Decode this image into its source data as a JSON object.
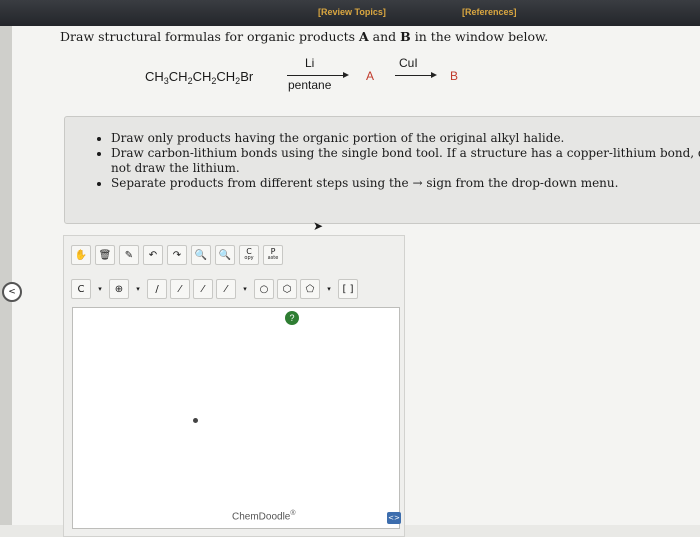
{
  "topbar": {
    "review_topics": "[Review Topics]",
    "references": "[References]"
  },
  "question": {
    "prefix": "Draw structural formulas for organic products ",
    "a": "A",
    "mid": " and ",
    "b": "B",
    "suffix": " in the window below."
  },
  "reaction": {
    "sm_parts": [
      "CH",
      "3",
      "CH",
      "2",
      "CH",
      "2",
      "CH",
      "2",
      "Br"
    ],
    "reagent1_top": "Li",
    "reagent1_bottom": "pentane",
    "product_a": "A",
    "reagent2_top": "CuI",
    "product_b": "B"
  },
  "instructions": [
    "Draw only products having the organic portion of the original alkyl halide.",
    "Draw carbon-lithium bonds using the single bond tool. If a structure has a copper-lithium bond, do not draw the lithium.",
    "Separate products from different steps using the → sign from the drop-down menu."
  ],
  "toolbar": {
    "row1": [
      "✋",
      "🗑",
      "✎",
      "↶",
      "↷",
      "🔍",
      "🔍",
      "C",
      "P"
    ],
    "row1_sub": [
      "",
      "",
      "",
      "",
      "",
      "",
      "",
      "opy",
      "aste"
    ],
    "row2": [
      "C",
      "▾",
      "⊕",
      "▾",
      "/",
      "⁄",
      "⁄",
      "⁄",
      "▾",
      "○",
      "⬡",
      "⬠",
      "▾",
      "[ ]"
    ]
  },
  "brand": "ChemDoodle",
  "brand_mark": "®",
  "help_label": "?",
  "nav_label": "<",
  "expand_label": "<>"
}
